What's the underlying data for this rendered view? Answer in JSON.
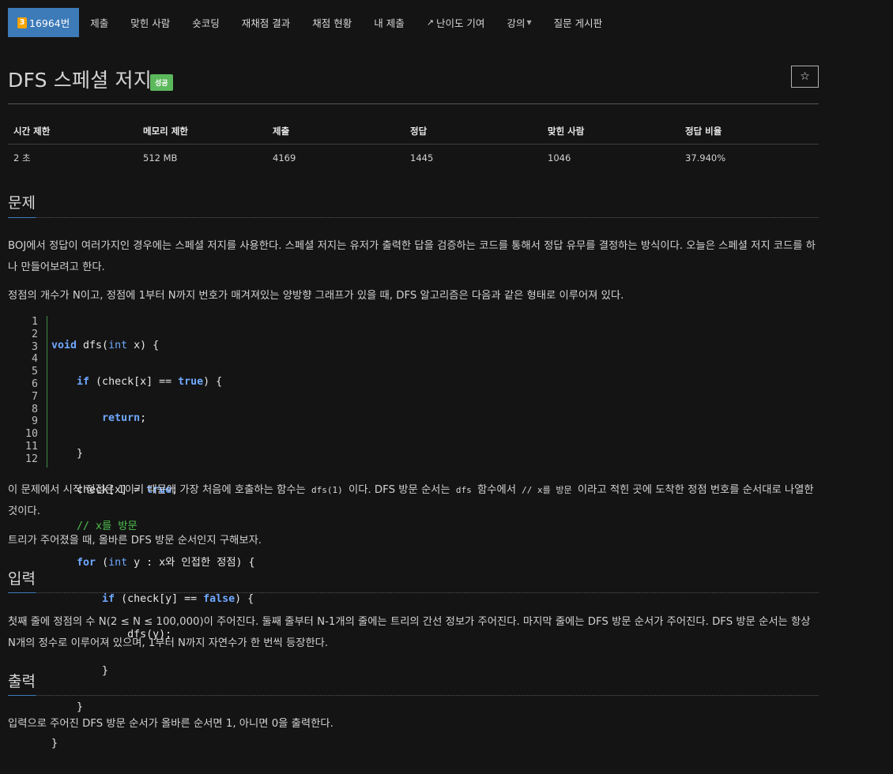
{
  "nav": {
    "problem_tier": "3",
    "problem_number": "16964번",
    "items": [
      "제출",
      "맞힌 사람",
      "숏코딩",
      "재채점 결과",
      "채점 현황",
      "내 제출",
      "난이도 기여",
      "강의"
    ],
    "board": "질문 게시판"
  },
  "problem": {
    "title": "DFS 스페셜 저지",
    "status_badge": "성공",
    "star": "☆"
  },
  "stats": {
    "headers": [
      "시간 제한",
      "메모리 제한",
      "제출",
      "정답",
      "맞힌 사람",
      "정답 비율"
    ],
    "values": [
      "2 초",
      "512 MB",
      "4169",
      "1445",
      "1046",
      "37.940%"
    ]
  },
  "sections": {
    "problem_heading": "문제",
    "input_heading": "입력",
    "output_heading": "출력"
  },
  "description": {
    "p1": "BOJ에서 정답이 여러가지인 경우에는 스페셜 저지를 사용한다. 스페셜 저지는 유저가 출력한 답을 검증하는 코드를 통해서 정답 유무를 결정하는 방식이다. 오늘은 스페셜 저지 코드를 하나 만들어보려고 한다.",
    "p2": "정점의 개수가 N이고, 정점에 1부터 N까지 번호가 매겨져있는 양방향 그래프가 있을 때, DFS 알고리즘은 다음과 같은 형태로 이루어져 있다.",
    "p3_a": "이 문제에서 시작 정점은 1이기 때문에 가장 처음에 호출하는 함수는",
    "p3_code1": "dfs(1)",
    "p3_b": "이다. DFS 방문 순서는",
    "p3_code2": "dfs",
    "p3_c": "함수에서",
    "p3_code3": "// x를 방문",
    "p3_d": "이라고 적힌 곳에 도착한 정점 번호를 순서대로 나열한 것이다.",
    "p4": "트리가 주어졌을 때, 올바른 DFS 방문 순서인지 구해보자."
  },
  "code": {
    "line_numbers": [
      "1",
      "2",
      "3",
      "4",
      "5",
      "6",
      "7",
      "8",
      "9",
      "10",
      "11",
      "12"
    ],
    "tokens": {
      "l1_kw": "void",
      "l1_a": " dfs(",
      "l1_ty": "int",
      "l1_b": " x) {",
      "l2_indent": "    ",
      "l2_kw": "if",
      "l2_a": " (check[x] == ",
      "l2_v": "true",
      "l2_b": ") {",
      "l3_indent": "        ",
      "l3_kw": "return",
      "l3_a": ";",
      "l4": "    }",
      "l5_a": "    check[x] = ",
      "l5_v": "true",
      "l5_b": ";",
      "l6_indent": "    ",
      "l6_cm": "// x를 방문",
      "l7_indent": "    ",
      "l7_kw": "for",
      "l7_a": " (",
      "l7_ty": "int",
      "l7_b": " y : x와 인접한 정점) {",
      "l8_indent": "        ",
      "l8_kw": "if",
      "l8_a": " (check[y] == ",
      "l8_v": "false",
      "l8_b": ") {",
      "l9": "            dfs(y);",
      "l10": "        }",
      "l11": "    }",
      "l12": "}"
    }
  },
  "input_text": "첫째 줄에 정점의 수 N(2 ≤ N ≤ 100,000)이 주어진다. 둘째 줄부터 N-1개의 줄에는 트리의 간선 정보가 주어진다. 마지막 줄에는 DFS 방문 순서가 주어진다. DFS 방문 순서는 항상 N개의 정수로 이루어져 있으며, 1부터 N까지 자연수가 한 번씩 등장한다.",
  "output_text": "입력으로 주어진 DFS 방문 순서가 올바른 순서면 1, 아니면 0을 출력한다."
}
